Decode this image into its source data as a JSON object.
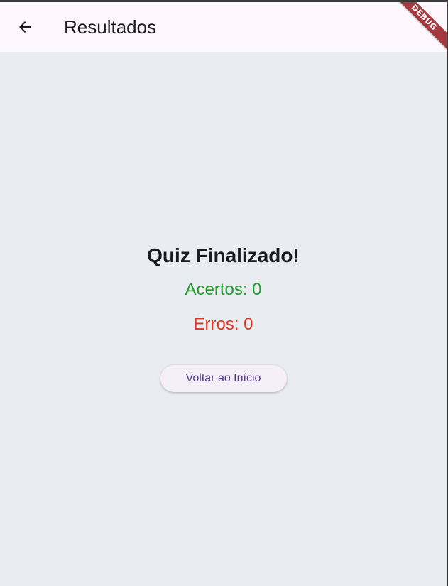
{
  "appbar": {
    "title": "Resultados",
    "back_icon": "arrow-back-icon",
    "debug_banner": "DEBUG"
  },
  "results": {
    "heading": "Quiz Finalizado!",
    "correct_label": "Acertos: 0",
    "wrong_label": "Erros: 0",
    "home_button_label": "Voltar ao Início"
  },
  "colors": {
    "appbar_bg": "#fdf7fd",
    "page_bg": "#e9ecf0",
    "correct": "#1f9e2c",
    "wrong": "#e0381f",
    "button_text": "#4f378b",
    "debug_ribbon": "#a8383f"
  }
}
